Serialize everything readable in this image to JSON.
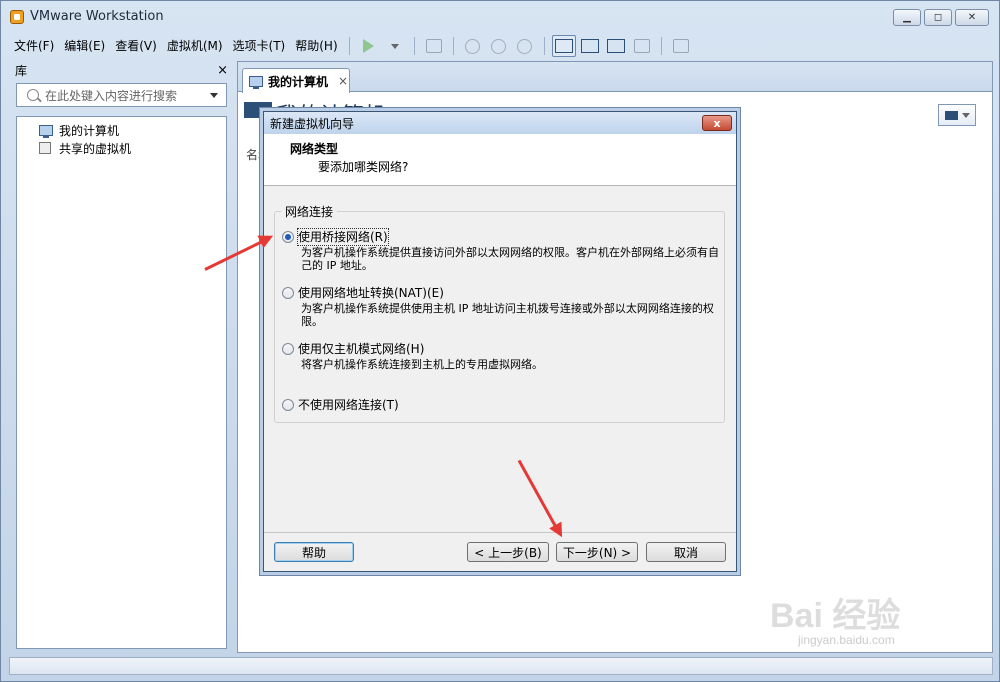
{
  "window": {
    "title": "VMware Workstation",
    "min_label": "▭",
    "max_label": "▣",
    "close_label": "✕"
  },
  "menu": [
    "文件(F)",
    "编辑(E)",
    "查看(V)",
    "虚拟机(M)",
    "选项卡(T)",
    "帮助(H)"
  ],
  "library": {
    "title": "库",
    "close": "×",
    "search_placeholder": "在此处键入内容进行搜索",
    "tree": [
      "我的计算机",
      "共享的虚拟机"
    ]
  },
  "tab": {
    "label": "我的计算机",
    "close": "×"
  },
  "home": {
    "title": "我的计算机",
    "column_name": "名称"
  },
  "dialog": {
    "title": "新建虚拟机向导",
    "close": "x",
    "heading": "网络类型",
    "subheading": "要添加哪类网络?",
    "group_label": "网络连接",
    "options": [
      {
        "label": "使用桥接网络(R)",
        "desc": "为客户机操作系统提供直接访问外部以太网网络的权限。客户机在外部网络上必须有自己的 IP 地址。",
        "selected": true
      },
      {
        "label": "使用网络地址转换(NAT)(E)",
        "desc": "为客户机操作系统提供使用主机 IP 地址访问主机拨号连接或外部以太网网络连接的权限。",
        "selected": false
      },
      {
        "label": "使用仅主机模式网络(H)",
        "desc": "将客户机操作系统连接到主机上的专用虚拟网络。",
        "selected": false
      },
      {
        "label": "不使用网络连接(T)",
        "desc": "",
        "selected": false
      }
    ],
    "buttons": {
      "help": "帮助",
      "back": "< 上一步(B)",
      "next": "下一步(N) >",
      "cancel": "取消"
    }
  },
  "watermark": {
    "brand": "Bai 经验",
    "url": "jingyan.baidu.com"
  },
  "colors": {
    "annotation_arrow": "#e53935",
    "selection_dot": "#1e5bb8"
  }
}
